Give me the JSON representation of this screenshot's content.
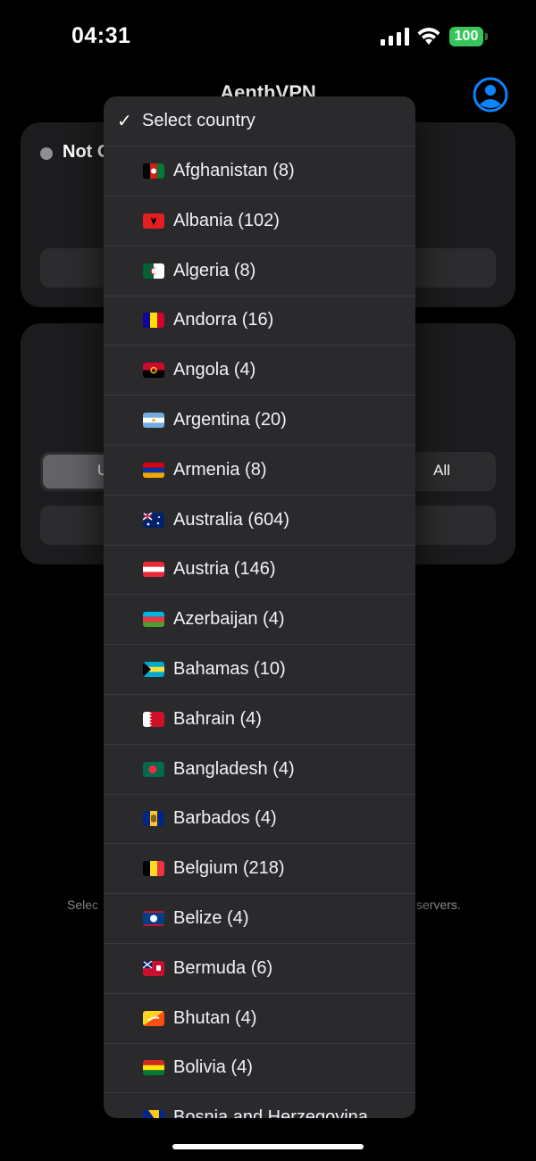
{
  "status_bar": {
    "time": "04:31",
    "battery": "100",
    "battery_color": "#35c759"
  },
  "header": {
    "title": "AenthVPN",
    "profile_icon": "person-circle-icon",
    "accent": "#0a84ff"
  },
  "connection_card": {
    "status": "Not C"
  },
  "server_card": {
    "segment_left": "U",
    "segment_right": "All"
  },
  "hint": {
    "left": "Selec",
    "right": "servers."
  },
  "dropdown": {
    "selected": "Select country",
    "countries": [
      {
        "label": "Afghanistan (8)",
        "flag": "afghanistan-flag-icon"
      },
      {
        "label": "Albania (102)",
        "flag": "albania-flag-icon"
      },
      {
        "label": "Algeria (8)",
        "flag": "algeria-flag-icon"
      },
      {
        "label": "Andorra (16)",
        "flag": "andorra-flag-icon"
      },
      {
        "label": "Angola (4)",
        "flag": "angola-flag-icon"
      },
      {
        "label": "Argentina (20)",
        "flag": "argentina-flag-icon"
      },
      {
        "label": "Armenia (8)",
        "flag": "armenia-flag-icon"
      },
      {
        "label": "Australia (604)",
        "flag": "australia-flag-icon"
      },
      {
        "label": "Austria (146)",
        "flag": "austria-flag-icon"
      },
      {
        "label": "Azerbaijan (4)",
        "flag": "azerbaijan-flag-icon"
      },
      {
        "label": "Bahamas (10)",
        "flag": "bahamas-flag-icon"
      },
      {
        "label": "Bahrain (4)",
        "flag": "bahrain-flag-icon"
      },
      {
        "label": "Bangladesh (4)",
        "flag": "bangladesh-flag-icon"
      },
      {
        "label": "Barbados (4)",
        "flag": "barbados-flag-icon"
      },
      {
        "label": "Belgium (218)",
        "flag": "belgium-flag-icon"
      },
      {
        "label": "Belize (4)",
        "flag": "belize-flag-icon"
      },
      {
        "label": "Bermuda (6)",
        "flag": "bermuda-flag-icon"
      },
      {
        "label": "Bhutan (4)",
        "flag": "bhutan-flag-icon"
      },
      {
        "label": "Bolivia (4)",
        "flag": "bolivia-flag-icon"
      },
      {
        "label": "Bosnia and Herzegovina",
        "flag": "bosnia-flag-icon"
      }
    ]
  }
}
